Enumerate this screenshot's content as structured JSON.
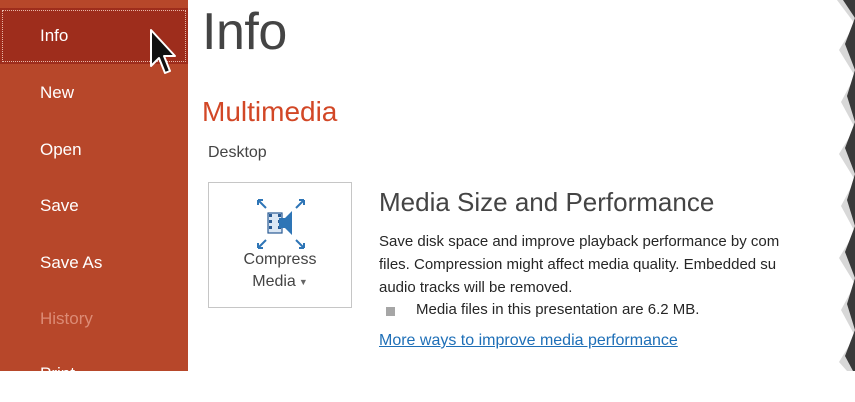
{
  "sidebar": {
    "items": [
      {
        "label": "Info",
        "state": "selected"
      },
      {
        "label": "New",
        "state": "normal"
      },
      {
        "label": "Open",
        "state": "normal"
      },
      {
        "label": "Save",
        "state": "normal"
      },
      {
        "label": "Save As",
        "state": "normal"
      },
      {
        "label": "History",
        "state": "disabled"
      },
      {
        "label": "Print",
        "state": "normal"
      }
    ],
    "background_color": "#b7472a",
    "selected_color": "#9e2d1c"
  },
  "main": {
    "title": "Info",
    "section_title": "Multimedia",
    "location": "Desktop",
    "compress_button": {
      "icon": "compress-media-icon",
      "label_line1": "Compress",
      "label_line2": "Media"
    },
    "info": {
      "title": "Media Size and Performance",
      "description_lines": [
        "Save disk space and improve playback performance by com",
        "files. Compression might affect media quality. Embedded su",
        "audio tracks will be removed."
      ],
      "bullet_text": "Media files in this presentation are 6.2 MB.",
      "link_text": "More ways to improve media performance"
    },
    "accent_color": "#d24726",
    "link_color": "#1e6fb7"
  }
}
